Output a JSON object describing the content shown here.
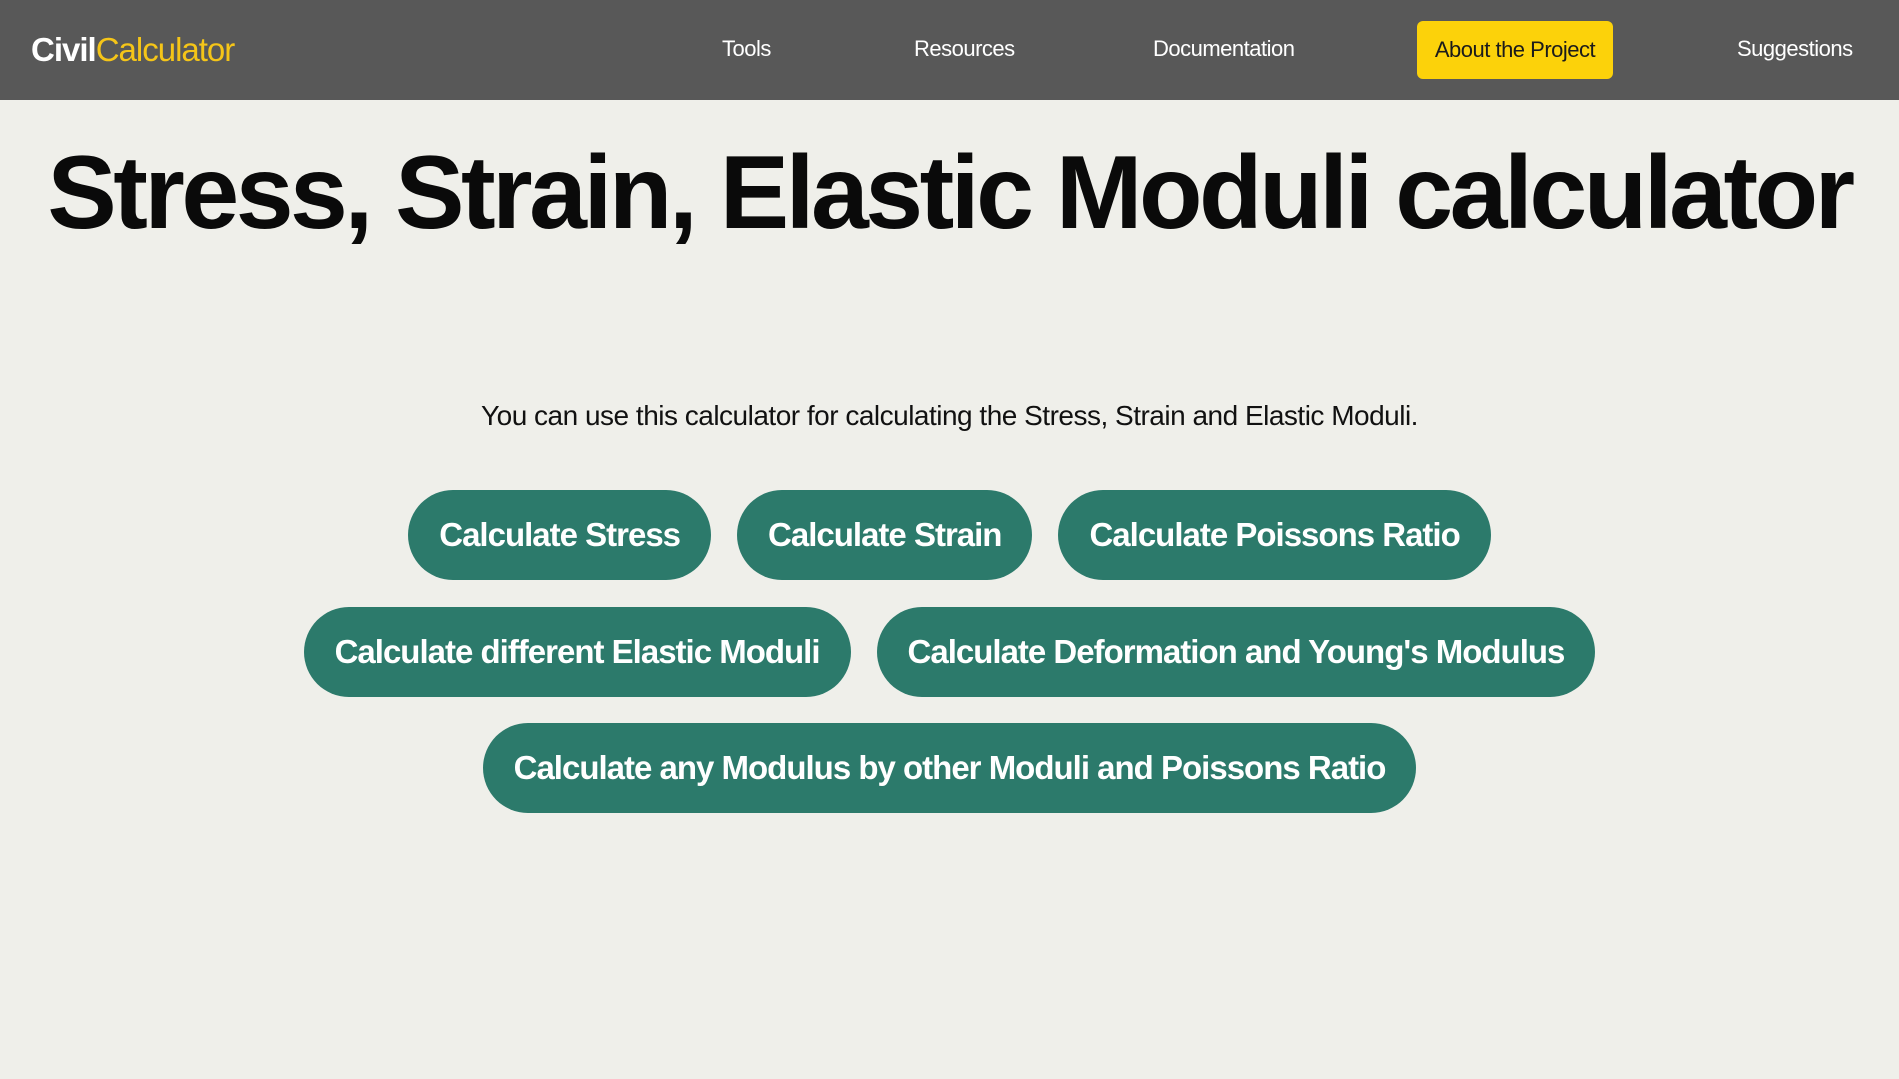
{
  "header": {
    "brand_civil": "Civil",
    "brand_calculator": "Calculator",
    "nav": {
      "tools": "Tools",
      "resources": "Resources",
      "documentation": "Documentation",
      "about": "About the Project",
      "suggestions": "Suggestions"
    }
  },
  "hero": {
    "title": "Stress, Strain, Elastic Moduli calculator",
    "subtitle": "You can use this calculator for calculating the Stress, Strain and Elastic Moduli."
  },
  "buttons": {
    "stress": "Calculate Stress",
    "strain": "Calculate Strain",
    "poissons": "Calculate Poissons Ratio",
    "elastic_moduli": "Calculate different Elastic Moduli",
    "deformation": "Calculate Deformation and Young's Modulus",
    "any_modulus": "Calculate any Modulus by other Moduli and Poissons Ratio"
  },
  "colors": {
    "header_bg": "#585858",
    "brand_accent": "#f5c518",
    "highlight_button": "#fcd20a",
    "pill_button": "#2c7a6b",
    "page_bg": "#efefea"
  }
}
